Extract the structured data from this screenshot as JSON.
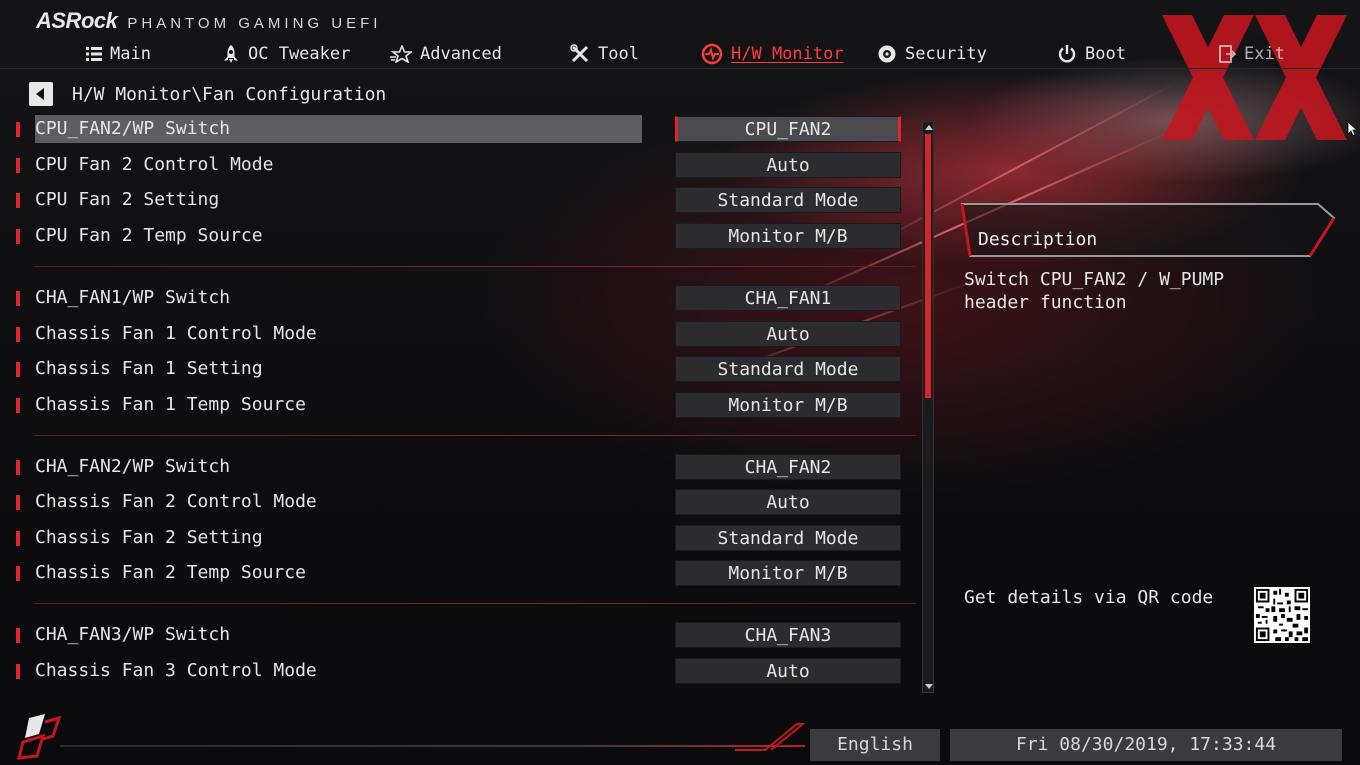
{
  "brand": {
    "logo": "ASRock",
    "subtitle": "PHANTOM GAMING UEFI"
  },
  "nav": {
    "items": [
      {
        "label": "Main",
        "icon": "list-icon"
      },
      {
        "label": "OC Tweaker",
        "icon": "rocket-icon"
      },
      {
        "label": "Advanced",
        "icon": "star-icon"
      },
      {
        "label": "Tool",
        "icon": "tools-icon"
      },
      {
        "label": "H/W Monitor",
        "icon": "monitor-gauge-icon",
        "active": true
      },
      {
        "label": "Security",
        "icon": "shield-gear-icon"
      },
      {
        "label": "Boot",
        "icon": "power-icon"
      },
      {
        "label": "Exit",
        "icon": "exit-door-icon"
      }
    ]
  },
  "breadcrumb": "H/W Monitor\\Fan Configuration",
  "settings": {
    "rows": [
      {
        "label": "CPU_FAN2/WP Switch",
        "value": "CPU_FAN2",
        "selected": true
      },
      {
        "label": "CPU Fan 2 Control Mode",
        "value": "Auto"
      },
      {
        "label": "CPU Fan 2 Setting",
        "value": "Standard Mode"
      },
      {
        "label": "CPU Fan 2 Temp Source",
        "value": "Monitor M/B"
      },
      {
        "label": "CHA_FAN1/WP Switch",
        "value": "CHA_FAN1"
      },
      {
        "label": "Chassis Fan 1 Control Mode",
        "value": "Auto"
      },
      {
        "label": "Chassis Fan 1 Setting",
        "value": "Standard Mode"
      },
      {
        "label": "Chassis Fan 1 Temp Source",
        "value": "Monitor M/B"
      },
      {
        "label": "CHA_FAN2/WP Switch",
        "value": "CHA_FAN2"
      },
      {
        "label": "Chassis Fan 2 Control Mode",
        "value": "Auto"
      },
      {
        "label": "Chassis Fan 2 Setting",
        "value": "Standard Mode"
      },
      {
        "label": "Chassis Fan 2 Temp Source",
        "value": "Monitor M/B"
      },
      {
        "label": "CHA_FAN3/WP Switch",
        "value": "CHA_FAN3"
      },
      {
        "label": "Chassis Fan 3 Control Mode",
        "value": "Auto"
      }
    ]
  },
  "description": {
    "title": "Description",
    "text": "Switch CPU_FAN2 / W_PUMP header function",
    "qr_hint": "Get details via QR code"
  },
  "footer": {
    "language": "English",
    "datetime": "Fri 08/30/2019, 17:33:44"
  },
  "colors": {
    "accent": "#e0262b",
    "active_tab": "#ff3b3b",
    "selected_row": "#5e5e62"
  }
}
